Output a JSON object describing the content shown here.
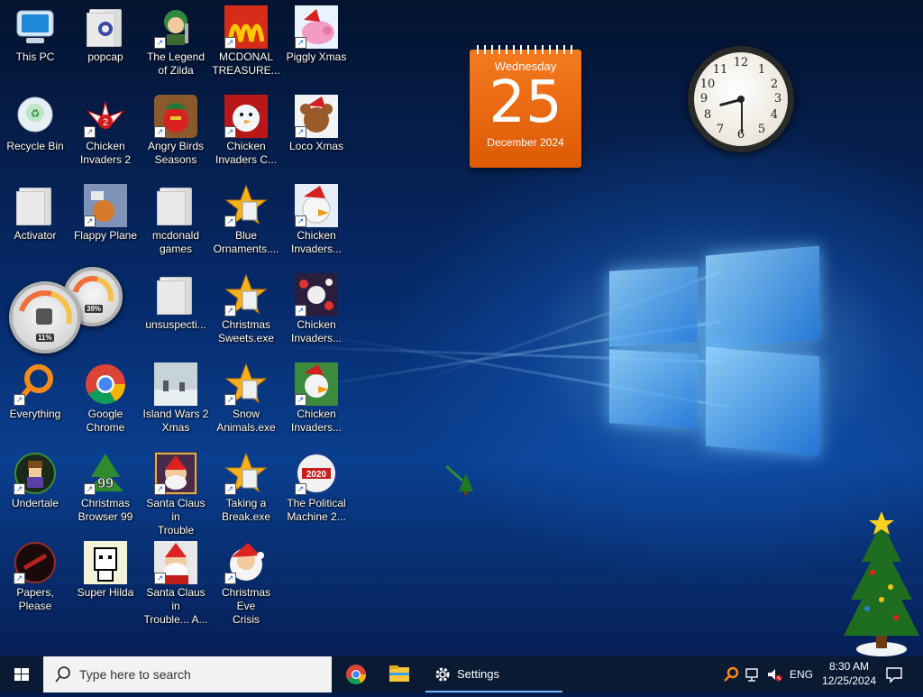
{
  "desktop": {
    "icons": [
      {
        "name": "this-pc",
        "label": "This PC"
      },
      {
        "name": "popcap",
        "label": "popcap"
      },
      {
        "name": "legend-of-zilda",
        "label": "The Legend\nof Zilda"
      },
      {
        "name": "mcdonal-treasure",
        "label": "MCDONAL\nTREASURE..."
      },
      {
        "name": "piggly-xmas",
        "label": "Piggly Xmas"
      },
      {
        "name": "recycle-bin",
        "label": "Recycle Bin"
      },
      {
        "name": "chicken-invaders-2",
        "label": "Chicken\nInvaders 2"
      },
      {
        "name": "angry-birds-seasons",
        "label": "Angry Birds\nSeasons"
      },
      {
        "name": "chicken-invaders-c",
        "label": "Chicken\nInvaders C..."
      },
      {
        "name": "loco-xmas",
        "label": "Loco Xmas"
      },
      {
        "name": "activator",
        "label": "Activator"
      },
      {
        "name": "flappy-plane",
        "label": "Flappy Plane"
      },
      {
        "name": "mcdonald-games",
        "label": "mcdonald\ngames"
      },
      {
        "name": "blue-ornaments",
        "label": "Blue\nOrnaments...."
      },
      {
        "name": "chicken-invaders-a",
        "label": "Chicken\nInvaders..."
      },
      {
        "name": "unsuspecti",
        "label": "unsuspecti..."
      },
      {
        "name": "christmas-sweets",
        "label": "Christmas\nSweets.exe"
      },
      {
        "name": "chicken-invaders-b",
        "label": "Chicken\nInvaders..."
      },
      {
        "name": "everything",
        "label": "Everything"
      },
      {
        "name": "google-chrome",
        "label": "Google\nChrome"
      },
      {
        "name": "island-wars-2-xmas",
        "label": "Island Wars 2\nXmas"
      },
      {
        "name": "snow-animals",
        "label": "Snow\nAnimals.exe"
      },
      {
        "name": "chicken-invaders-d",
        "label": "Chicken\nInvaders..."
      },
      {
        "name": "undertale",
        "label": "Undertale"
      },
      {
        "name": "christmas-browser-99",
        "label": "Christmas\nBrowser 99"
      },
      {
        "name": "santa-claus-in-trouble",
        "label": "Santa Claus in\nTrouble"
      },
      {
        "name": "taking-a-break",
        "label": "Taking a\nBreak.exe"
      },
      {
        "name": "political-machine",
        "label": "The Political\nMachine 2..."
      },
      {
        "name": "papers-please",
        "label": "Papers, Please"
      },
      {
        "name": "super-hilda",
        "label": "Super Hilda"
      },
      {
        "name": "santa-claus-in-trouble-a",
        "label": "Santa Claus in\nTrouble... A..."
      },
      {
        "name": "christmas-eve-crisis",
        "label": "Christmas Eve\nCrisis"
      }
    ],
    "gauge_values": {
      "cpu": "11%",
      "memory": "39%"
    },
    "clock": {
      "numerals": [
        "12",
        "1",
        "2",
        "3",
        "4",
        "5",
        "6",
        "7",
        "8",
        "9",
        "10",
        "11"
      ]
    },
    "calendar": {
      "weekday": "Wednesday",
      "day": "25",
      "month_year": "December 2024"
    }
  },
  "taskbar": {
    "search_placeholder": "Type here to search",
    "settings_label": "Settings",
    "language": "ENG",
    "time": "8:30 AM",
    "date": "12/25/2024"
  }
}
